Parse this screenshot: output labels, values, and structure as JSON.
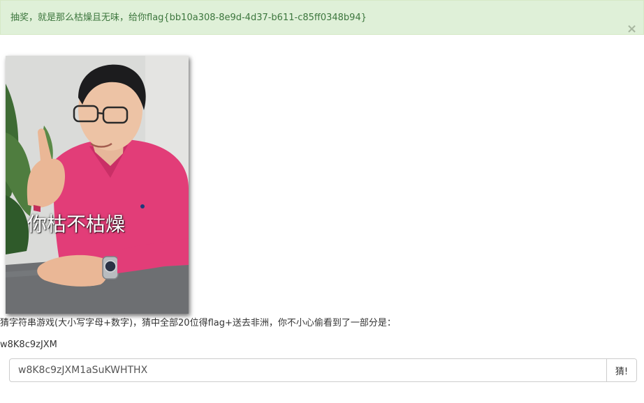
{
  "alert": {
    "message": "抽奖，就是那么枯燥且无味，给你flag{bb10a308-8e9d-4d37-b611-c85ff0348b94}",
    "close_icon": "close-icon",
    "close_glyph": "×",
    "background": "#dff0d8",
    "text_color": "#3c763d"
  },
  "meme": {
    "caption": "你枯不枯燥"
  },
  "game": {
    "description": "猜字符串游戏(大小写字母+数字)，猜中全部20位得flag+送去非洲，你不小心偷看到了一部分是：",
    "partial_string": "w8K8c9zJXM",
    "input_value": "w8K8c9zJXM1aSuKWHTHX",
    "button_label": "猜!"
  }
}
